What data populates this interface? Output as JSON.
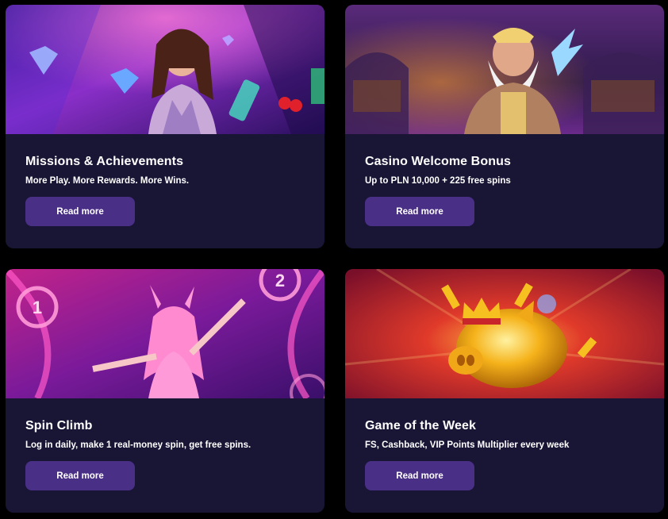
{
  "cards": [
    {
      "title": "Missions & Achievements",
      "subtitle": "More Play. More Rewards. More Wins.",
      "button_label": "Read more",
      "image": "woman-with-diamonds-illustration"
    },
    {
      "title": "Casino Welcome Bonus",
      "subtitle": "Up to PLN 10,000 + 225 free spins",
      "button_label": "Read more",
      "image": "zeus-illustration"
    },
    {
      "title": "Spin Climb",
      "subtitle": "Log in daily, make 1 real-money spin, get free spins.",
      "button_label": "Read more",
      "image": "bunny-girl-illustration",
      "banner_numbers": [
        "1",
        "2"
      ]
    },
    {
      "title": "Game of the Week",
      "subtitle": "FS, Cashback, VIP Points Multiplier every week",
      "button_label": "Read more",
      "image": "golden-piggy-bank-illustration"
    }
  ],
  "colors": {
    "page_bg": "#000000",
    "card_bg": "#181535",
    "button_bg": "#4a2f87",
    "text": "#ffffff"
  }
}
